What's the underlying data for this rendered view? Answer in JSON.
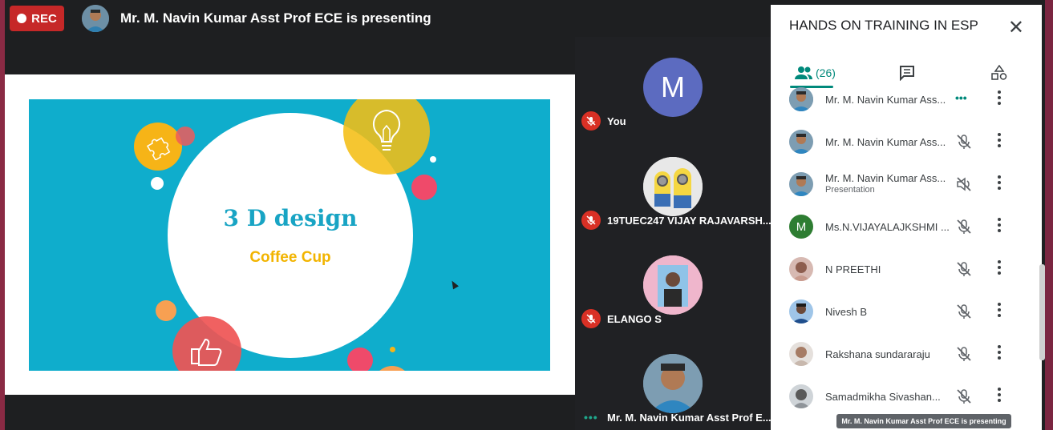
{
  "recording": {
    "label": "REC"
  },
  "presenter_banner": {
    "text": "Mr. M. Navin Kumar Asst Prof ECE is presenting"
  },
  "slide": {
    "title": "3 D design",
    "subtitle": "Coffee Cup"
  },
  "tiles": [
    {
      "initial": "M",
      "name": "You",
      "avatar_color": "#5c6bc0",
      "status": "muted"
    },
    {
      "name": "19TUEC247 VIJAY RAJAVARSH...",
      "status": "muted"
    },
    {
      "name": "ELANGO S",
      "status": "muted"
    },
    {
      "name": "Mr. M. Navin Kumar Asst Prof E...",
      "status": "speaking",
      "speaking_indicator": "•••"
    }
  ],
  "panel": {
    "title": "HANDS ON TRAINING IN ESP",
    "close_icon": "close-icon",
    "people_count": "(26)",
    "tabs": [
      "people-icon",
      "chat-icon",
      "activities-icon"
    ],
    "participants": [
      {
        "name": "Mr. M. Navin Kumar Ass...",
        "state": "speaking",
        "speaking_indicator": "•••"
      },
      {
        "name": "Mr. M. Navin Kumar Ass...",
        "state": "mic-off"
      },
      {
        "name": "Mr. M. Navin Kumar Ass...",
        "subtitle": "Presentation",
        "state": "volume-off"
      },
      {
        "name": "Ms.N.VIJAYALAJKSHMI ...",
        "initial": "M",
        "avatar_color": "#2e7d32",
        "state": "mic-off"
      },
      {
        "name": "N PREETHI",
        "state": "mic-off"
      },
      {
        "name": "Nivesh B",
        "state": "mic-off"
      },
      {
        "name": "Rakshana sundararaju",
        "state": "mic-off"
      },
      {
        "name": "Samadmikha Sivashan...",
        "state": "mic-off"
      }
    ]
  },
  "tooltip": {
    "text": "Mr. M. Navin Kumar Asst Prof ECE is presenting"
  },
  "colors": {
    "accent": "#00897b",
    "rec": "#c62828",
    "slide_bg": "#0fadcc"
  }
}
